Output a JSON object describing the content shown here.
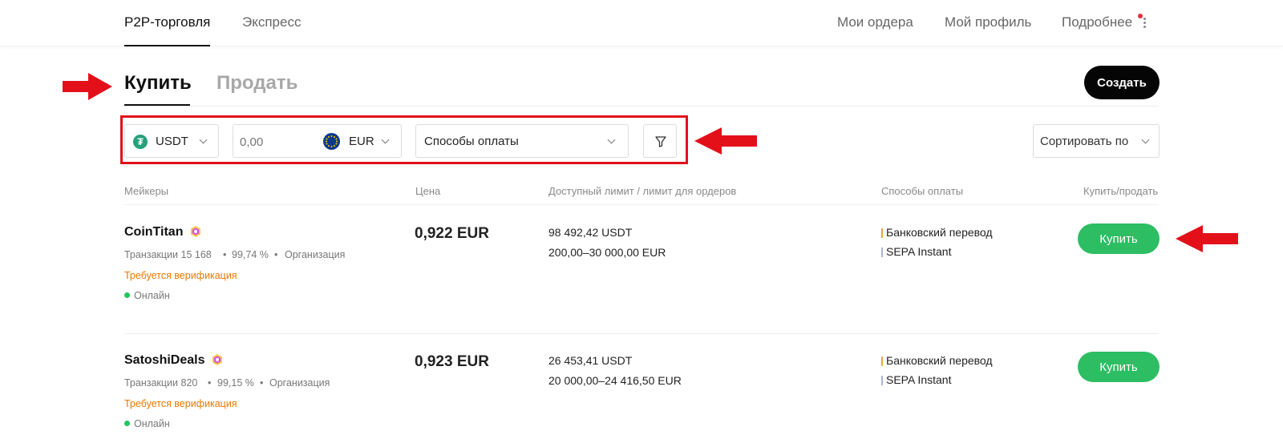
{
  "topnav": {
    "tabs": [
      {
        "label": "P2P-торговля",
        "active": true
      },
      {
        "label": "Экспресс",
        "active": false
      }
    ],
    "right": [
      "Мои ордера",
      "Мой профиль",
      "Подробнее"
    ]
  },
  "trade": {
    "buy_label": "Купить",
    "sell_label": "Продать",
    "create_label": "Создать"
  },
  "filters": {
    "crypto": "USDT",
    "amount_placeholder": "0,00",
    "fiat": "EUR",
    "payment_placeholder": "Способы оплаты",
    "sort_label": "Сортировать по"
  },
  "table": {
    "headers": [
      "Мейкеры",
      "Цена",
      "Доступный лимит / лимит для ордеров",
      "Способы оплаты",
      "Купить/продать"
    ],
    "rows": [
      {
        "name": "CoinTitan",
        "trades": "Транзакции 15 168",
        "rate": "99,74 %",
        "type": "Организация",
        "verify": "Требуется верификация",
        "status": "Онлайн",
        "price": "0,922 EUR",
        "available": "98 492,42 USDT",
        "limit": "200,00–30 000,00 EUR",
        "payments": [
          "Банковский перевод",
          "SEPA Instant"
        ],
        "action": "Купить"
      },
      {
        "name": "SatoshiDeals",
        "trades": "Транзакции 820",
        "rate": "99,15 %",
        "type": "Организация",
        "verify": "Требуется верификация",
        "status": "Онлайн",
        "price": "0,923 EUR",
        "available": "26 453,41 USDT",
        "limit": "20 000,00–24 416,50 EUR",
        "payments": [
          "Банковский перевод",
          "SEPA Instant"
        ],
        "action": "Купить"
      }
    ]
  },
  "colors": {
    "accent_green": "#2dbd63",
    "verify_orange": "#e87a00",
    "annotation_red": "#e3101a"
  }
}
